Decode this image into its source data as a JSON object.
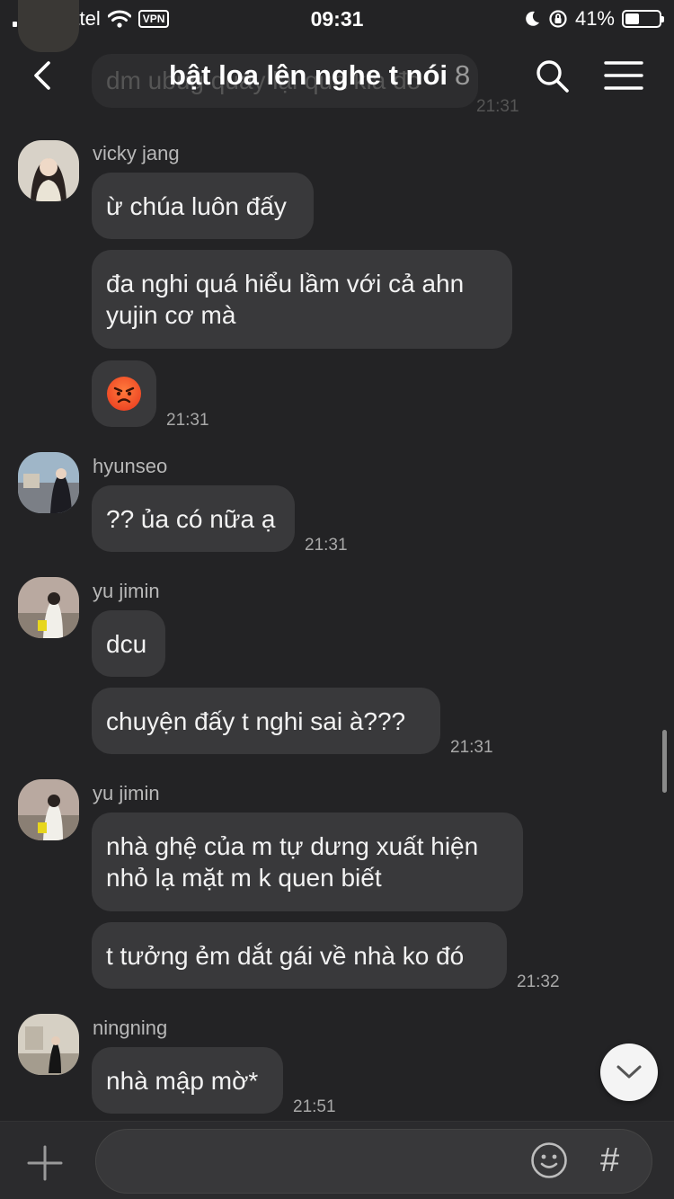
{
  "status": {
    "carrier": "Viettel",
    "vpn": "VPN",
    "time": "09:31",
    "battery": "41%",
    "battery_level": 0.41
  },
  "ghost": {
    "text": "dm ubug quay lại qua kia đó",
    "time": "21:31"
  },
  "header": {
    "title": "bật loa lên nghe t nói",
    "count": "8"
  },
  "groups": [
    {
      "sender": "vicky jang",
      "messages": [
        {
          "text": "ừ chúa luôn đấy"
        },
        {
          "text": "đa nghi quá hiểu lầm với cả ahn yujin cơ mà"
        },
        {
          "emoji": "angry-face",
          "time": "21:31"
        }
      ]
    },
    {
      "sender": "hyunseo",
      "messages": [
        {
          "text": "?? ủa có nữa ạ",
          "time": "21:31"
        }
      ]
    },
    {
      "sender": "yu jimin",
      "messages": [
        {
          "text": "dcu"
        },
        {
          "text": "chuyện đấy t nghi sai à???",
          "time": "21:31"
        }
      ]
    },
    {
      "sender": "yu jimin",
      "messages": [
        {
          "text": "nhà ghệ của m tự dưng xuất hiện nhỏ lạ mặt m k quen biết"
        },
        {
          "text": "t tưởng ẻm dắt gái về nhà ko đó",
          "time": "21:32"
        }
      ]
    },
    {
      "sender": "ningning",
      "messages": [
        {
          "text": "nhà mập mờ*",
          "time": "21:51"
        }
      ]
    }
  ],
  "composer": {
    "placeholder": "",
    "hash": "#"
  },
  "icons": {
    "back": "chevron-left-icon",
    "search": "search-icon",
    "menu": "hamburger-menu-icon",
    "plus": "plus-icon",
    "emoji": "smiley-icon",
    "scroll_down": "chevron-down-icon"
  }
}
